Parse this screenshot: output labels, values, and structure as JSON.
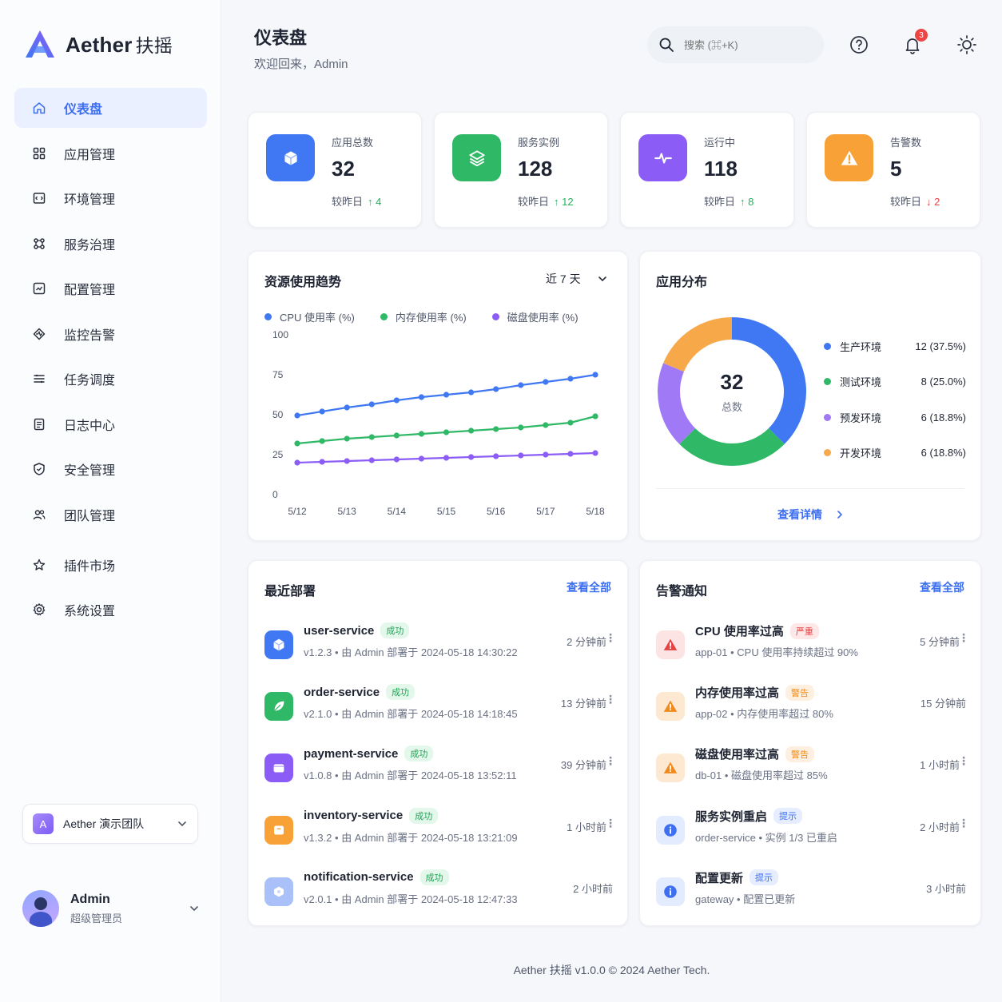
{
  "brand": {
    "name": "Aether",
    "name_cn": "扶摇"
  },
  "sidebar": {
    "items": [
      {
        "label": "仪表盘",
        "icon": "home-icon",
        "active": true
      },
      {
        "label": "应用管理",
        "icon": "grid-icon"
      },
      {
        "label": "环境管理",
        "icon": "environment-icon"
      },
      {
        "label": "服务治理",
        "icon": "network-icon"
      },
      {
        "label": "配置管理",
        "icon": "config-icon"
      },
      {
        "label": "监控告警",
        "icon": "monitor-icon"
      },
      {
        "label": "任务调度",
        "icon": "schedule-icon"
      },
      {
        "label": "日志中心",
        "icon": "log-icon"
      },
      {
        "label": "安全管理",
        "icon": "shield-icon"
      },
      {
        "label": "团队管理",
        "icon": "team-icon"
      },
      {
        "label": "插件市场",
        "icon": "plugin-icon"
      },
      {
        "label": "系统设置",
        "icon": "gear-icon"
      }
    ],
    "team": {
      "badge": "A",
      "name": "Aether 演示团队"
    },
    "user": {
      "name": "Admin",
      "role": "超级管理员"
    }
  },
  "header": {
    "title": "仪表盘",
    "subtitle": "欢迎回来，Admin",
    "search_placeholder": "搜索 (⌘+K)",
    "notification_count": "3"
  },
  "stats": [
    {
      "label": "应用总数",
      "value": "32",
      "delta_prefix": "较昨日",
      "delta": "↑ 4",
      "trend": "up",
      "color": "#3f78f2",
      "icon": "cube-icon"
    },
    {
      "label": "服务实例",
      "value": "128",
      "delta_prefix": "较昨日",
      "delta": "↑ 12",
      "trend": "up",
      "color": "#2fb866",
      "icon": "layers-icon"
    },
    {
      "label": "运行中",
      "value": "118",
      "delta_prefix": "较昨日",
      "delta": "↑ 8",
      "trend": "up",
      "color": "#8b5cf6",
      "icon": "pulse-icon"
    },
    {
      "label": "告警数",
      "value": "5",
      "delta_prefix": "较昨日",
      "delta": "↓ 2",
      "trend": "down",
      "color": "#f7a136",
      "icon": "warning-icon"
    }
  ],
  "trend": {
    "title": "资源使用趋势",
    "range": "近 7 天"
  },
  "distribution": {
    "title": "应用分布",
    "total": "32",
    "total_label": "总数",
    "details_link": "查看详情"
  },
  "deployments": {
    "title": "最近部署",
    "view_all": "查看全部",
    "items": [
      {
        "name": "user-service",
        "status": "成功",
        "meta": "v1.2.3 • 由 Admin 部署于 2024-05-18 14:30:22",
        "time": "2 分钟前",
        "color": "#3f78f2",
        "icon": "cube-icon"
      },
      {
        "name": "order-service",
        "status": "成功",
        "meta": "v2.1.0 • 由 Admin 部署于 2024-05-18 14:18:45",
        "time": "13 分钟前",
        "color": "#2fb866",
        "icon": "leaf-icon"
      },
      {
        "name": "payment-service",
        "status": "成功",
        "meta": "v1.0.8 • 由 Admin 部署于 2024-05-18 13:52:11",
        "time": "39 分钟前",
        "color": "#8b5cf6",
        "icon": "wallet-icon"
      },
      {
        "name": "inventory-service",
        "status": "成功",
        "meta": "v1.3.2 • 由 Admin 部署于 2024-05-18 13:21:09",
        "time": "1 小时前",
        "color": "#f7a136",
        "icon": "box-icon"
      },
      {
        "name": "notification-service",
        "status": "成功",
        "meta": "v2.0.1 • 由 Admin 部署于 2024-05-18 12:47:33",
        "time": "2 小时前",
        "color": "#a9c1f8",
        "icon": "bell-icon"
      }
    ]
  },
  "alerts": {
    "title": "告警通知",
    "view_all": "查看全部",
    "items": [
      {
        "title": "CPU 使用率过高",
        "level": "严重",
        "level_type": "crit",
        "meta": "app-01 • CPU 使用率持续超过 90%",
        "time": "5 分钟前",
        "icon": "alert-red-icon"
      },
      {
        "title": "内存使用率过高",
        "level": "警告",
        "level_type": "warn",
        "meta": "app-02 • 内存使用率超过 80%",
        "time": "15 分钟前",
        "icon": "alert-orange-icon"
      },
      {
        "title": "磁盘使用率过高",
        "level": "警告",
        "level_type": "warn",
        "meta": "db-01 • 磁盘使用率超过 85%",
        "time": "1 小时前",
        "icon": "alert-orange-icon"
      },
      {
        "title": "服务实例重启",
        "level": "提示",
        "level_type": "info",
        "meta": "order-service • 实例 1/3 已重启",
        "time": "2 小时前",
        "icon": "info-icon"
      },
      {
        "title": "配置更新",
        "level": "提示",
        "level_type": "info",
        "meta": "gateway • 配置已更新",
        "time": "3 小时前",
        "icon": "info-icon"
      }
    ]
  },
  "footer": "Aether 扶摇 v1.0.0 © 2024 Aether Tech.",
  "chart_data": [
    {
      "type": "line",
      "x": [
        "5/12",
        "5/13",
        "5/14",
        "5/15",
        "5/16",
        "5/17",
        "5/18"
      ],
      "ylim": [
        0,
        100
      ],
      "yticks": [
        0,
        25,
        50,
        75,
        100
      ],
      "grid": false,
      "legend": "top-left",
      "series": [
        {
          "name": "CPU 使用率 (%)",
          "color": "#3f78f2",
          "values": [
            49.5,
            52,
            54.5,
            56.5,
            59,
            61,
            62.5,
            64,
            66,
            68.5,
            70.5,
            72.5,
            75
          ]
        },
        {
          "name": "内存使用率 (%)",
          "color": "#2fb866",
          "values": [
            32,
            33.5,
            35,
            36,
            37,
            38,
            39,
            40,
            41,
            42,
            43.5,
            45,
            49
          ]
        },
        {
          "name": "磁盘使用率 (%)",
          "color": "#8b5cf6",
          "values": [
            20,
            20.5,
            21,
            21.5,
            22,
            22.5,
            23,
            23.5,
            24,
            24.5,
            25,
            25.5,
            26
          ]
        }
      ]
    },
    {
      "type": "pie",
      "donut": true,
      "legend": "right",
      "labels": [
        "生产环境",
        "测试环境",
        "预发环境",
        "开发环境"
      ],
      "values": [
        12,
        8,
        6,
        6
      ],
      "value_labels": [
        "12 (37.5%)",
        "8 (25.0%)",
        "6 (18.8%)",
        "6 (18.8%)"
      ],
      "colors": [
        "#3f78f2",
        "#2fb866",
        "#a07af6",
        "#f7a949"
      ]
    }
  ]
}
